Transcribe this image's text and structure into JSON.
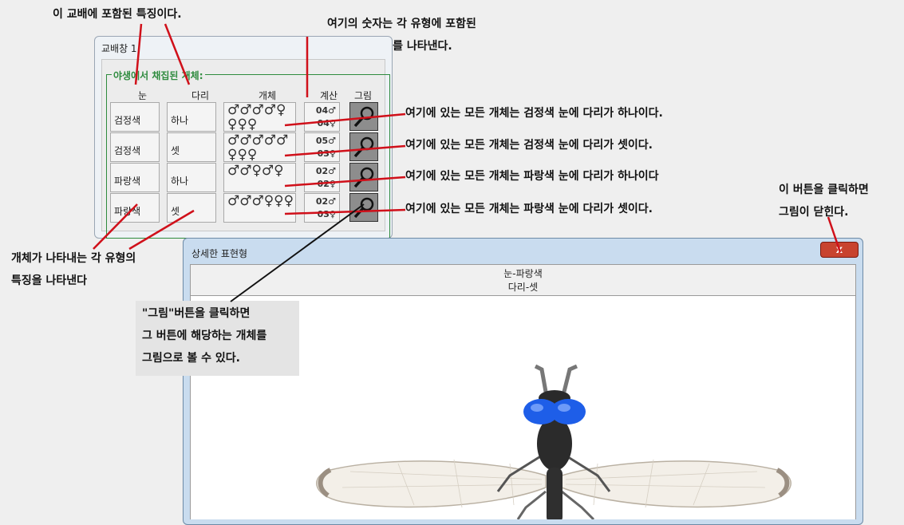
{
  "annotations": {
    "cross_features": "이 교배에 포함된 특징이다.",
    "count_note": [
      "여기의 숫자는 각 유형에 포함된",
      "암수의 개체수를 나타낸다."
    ],
    "row_notes": [
      "여기에 있는 모든 개체는 검정색 눈에 다리가 하나이다.",
      "여기에 있는 모든 개체는 검정색 눈에 다리가 셋이다.",
      "여기에 있는 모든 개체는 파랑색 눈에 다리가 하나이다",
      "여기에 있는 모든 개체는 파랑색 눈에 다리가 셋이다."
    ],
    "close_note": [
      "이 버튼을 클릭하면",
      "그림이 닫힌다."
    ],
    "type_note": [
      "개체가 나타내는 각 유형의",
      "특징을 나타낸다"
    ],
    "picture_note": [
      "\"그림\"버튼을 클릭하면",
      "그 버튼에 해당하는 개체를",
      "그림으로 볼 수 있다."
    ]
  },
  "cross_window": {
    "title": "교배창 1",
    "group_label": "야생에서 채집된 개체:",
    "headers": {
      "eye": "눈",
      "leg": "다리",
      "individuals": "개체",
      "count": "계산",
      "picture": "그림"
    },
    "rows": [
      {
        "eye": "검정색",
        "leg": "하나",
        "symbols": "♂♂♂♂♀♀♀♀",
        "male": "04♂",
        "female": "04♀"
      },
      {
        "eye": "검정색",
        "leg": "셋",
        "symbols": "♂♂♂♂♂♀♀♀",
        "male": "05♂",
        "female": "03♀"
      },
      {
        "eye": "파랑색",
        "leg": "하나",
        "symbols": "♂♂♀♂♀",
        "male": "02♂",
        "female": "02♀"
      },
      {
        "eye": "파랑색",
        "leg": "셋",
        "symbols": "♂♂♂♀♀♀",
        "male": "02♂",
        "female": "03♀"
      }
    ]
  },
  "detail_window": {
    "title": "상세한 표현형",
    "close_label": "x",
    "phenotype_eye": "눈-파랑색",
    "phenotype_leg": "다리-셋"
  },
  "colors": {
    "pointer_red": "#d0101a",
    "group_green": "#2e8b3e",
    "eye_blue": "#1e5ee8"
  }
}
